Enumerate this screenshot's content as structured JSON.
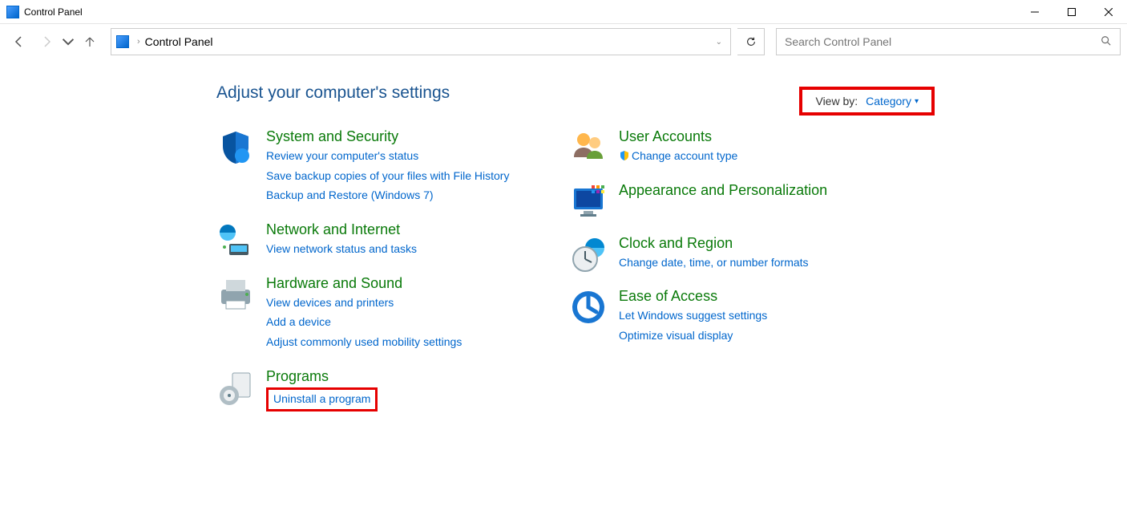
{
  "title": "Control Panel",
  "breadcrumb": "Control Panel",
  "search": {
    "placeholder": "Search Control Panel"
  },
  "heading": "Adjust your computer's settings",
  "viewby": {
    "label": "View by:",
    "value": "Category"
  },
  "left": [
    {
      "title": "System and Security",
      "links": [
        "Review your computer's status",
        "Save backup copies of your files with File History",
        "Backup and Restore (Windows 7)"
      ]
    },
    {
      "title": "Network and Internet",
      "links": [
        "View network status and tasks"
      ]
    },
    {
      "title": "Hardware and Sound",
      "links": [
        "View devices and printers",
        "Add a device",
        "Adjust commonly used mobility settings"
      ]
    },
    {
      "title": "Programs",
      "links": [
        "Uninstall a program"
      ]
    }
  ],
  "right": [
    {
      "title": "User Accounts",
      "links": [
        "Change account type"
      ]
    },
    {
      "title": "Appearance and Personalization",
      "links": []
    },
    {
      "title": "Clock and Region",
      "links": [
        "Change date, time, or number formats"
      ]
    },
    {
      "title": "Ease of Access",
      "links": [
        "Let Windows suggest settings",
        "Optimize visual display"
      ]
    }
  ]
}
